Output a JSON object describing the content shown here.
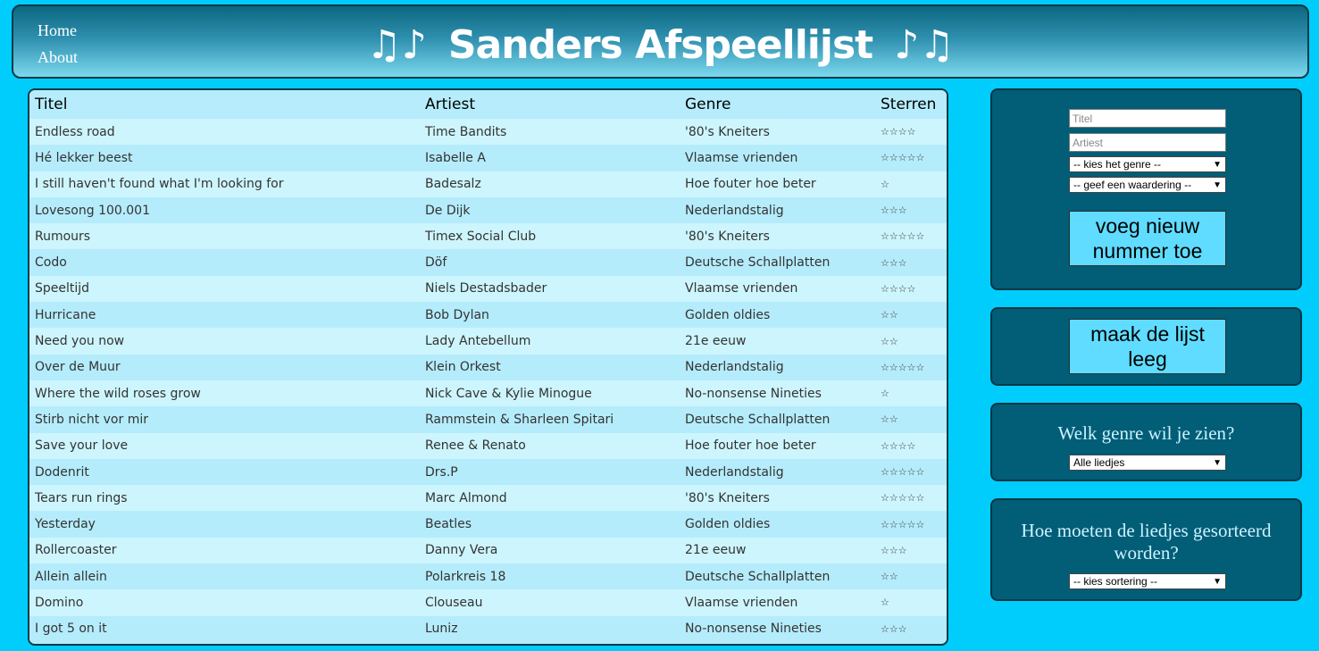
{
  "nav": {
    "home": "Home",
    "about": "About"
  },
  "header": {
    "title": "Sanders Afspeellijst",
    "notes_left": "♫♪",
    "notes_right": "♪♫"
  },
  "table": {
    "columns": [
      "Titel",
      "Artiest",
      "Genre",
      "Sterren"
    ],
    "rows": [
      [
        "Endless road",
        "Time Bandits",
        "'80's Kneiters",
        "☆☆☆☆"
      ],
      [
        "Hé lekker beest",
        "Isabelle A",
        "Vlaamse vrienden",
        "☆☆☆☆☆"
      ],
      [
        "I still haven't found what I'm looking for",
        "Badesalz",
        "Hoe fouter hoe beter",
        "☆"
      ],
      [
        "Lovesong 100.001",
        "De Dijk",
        "Nederlandstalig",
        "☆☆☆"
      ],
      [
        "Rumours",
        "Timex Social Club",
        "'80's Kneiters",
        "☆☆☆☆☆"
      ],
      [
        "Codo",
        "Döf",
        "Deutsche Schallplatten",
        "☆☆☆"
      ],
      [
        "Speeltijd",
        "Niels Destadsbader",
        "Vlaamse vrienden",
        "☆☆☆☆"
      ],
      [
        "Hurricane",
        "Bob Dylan",
        "Golden oldies",
        "☆☆"
      ],
      [
        "Need you now",
        "Lady Antebellum",
        "21e eeuw",
        "☆☆"
      ],
      [
        "Over de Muur",
        "Klein Orkest",
        "Nederlandstalig",
        "☆☆☆☆☆"
      ],
      [
        "Where the wild roses grow",
        "Nick Cave & Kylie Minogue",
        "No-nonsense Nineties",
        "☆"
      ],
      [
        "Stirb nicht vor mir",
        "Rammstein & Sharleen Spitari",
        "Deutsche Schallplatten",
        "☆☆"
      ],
      [
        "Save your love",
        "Renee & Renato",
        "Hoe fouter hoe beter",
        "☆☆☆☆"
      ],
      [
        "Dodenrit",
        "Drs.P",
        "Nederlandstalig",
        "☆☆☆☆☆"
      ],
      [
        "Tears run rings",
        "Marc Almond",
        "'80's Kneiters",
        "☆☆☆☆☆"
      ],
      [
        "Yesterday",
        "Beatles",
        "Golden oldies",
        "☆☆☆☆☆"
      ],
      [
        "Rollercoaster",
        "Danny Vera",
        "21e eeuw",
        "☆☆☆"
      ],
      [
        "Allein allein",
        "Polarkreis 18",
        "Deutsche Schallplatten",
        "☆☆"
      ],
      [
        "Domino",
        "Clouseau",
        "Vlaamse vrienden",
        "☆"
      ],
      [
        "I got 5 on it",
        "Luniz",
        "No-nonsense Nineties",
        "☆☆☆"
      ]
    ]
  },
  "form": {
    "title_placeholder": "Titel",
    "artist_placeholder": "Artiest",
    "genre_select": "-- kies het genre --",
    "rating_select": "-- geef een waardering --",
    "add_button": "voeg nieuw nummer toe"
  },
  "clear": {
    "button": "maak de lijst leeg"
  },
  "filter": {
    "question": "Welk genre wil je zien?",
    "select": "Alle liedjes"
  },
  "sort": {
    "question": "Hoe moeten de liedjes gesorteerd worden?",
    "select": "-- kies sortering --"
  },
  "colors": {
    "background": "#00cdfb",
    "panel": "#025d77",
    "button": "#5fdcff",
    "row_odd": "#cdf5fd",
    "row_even": "#b5ecfb"
  }
}
